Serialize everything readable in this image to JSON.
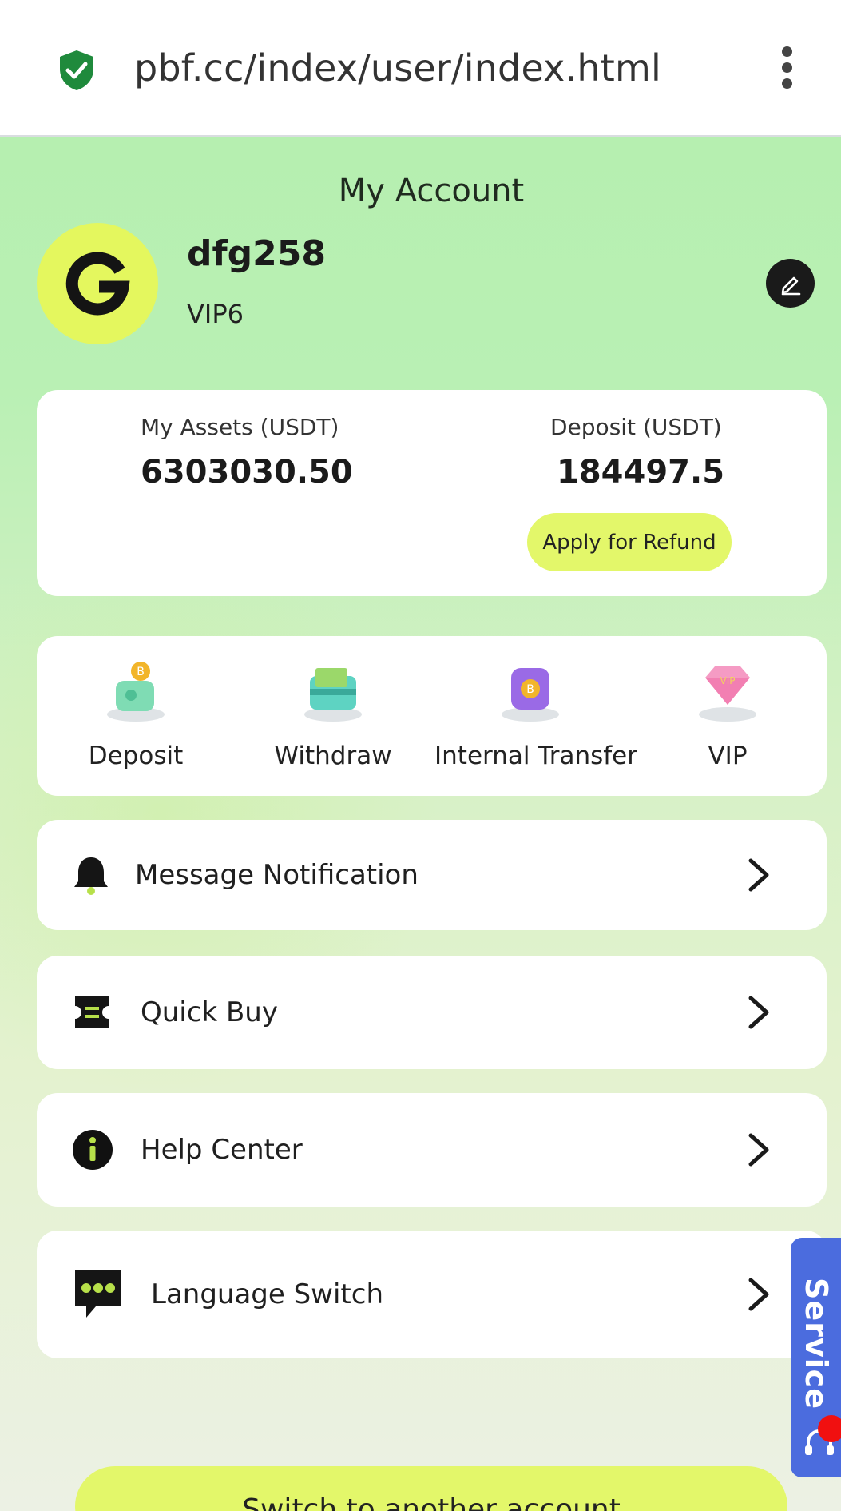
{
  "browser": {
    "url": "pbf.cc/index/user/index.html",
    "secure_icon": "shield-check-icon",
    "menu_icon": "kebab-menu-icon"
  },
  "header": {
    "title": "My Account"
  },
  "profile": {
    "avatar_letter": "G",
    "username": "dfg258",
    "vip_level": "VIP6",
    "edit_icon": "pencil-icon"
  },
  "assets": {
    "assets_label": "My Assets (USDT)",
    "assets_value": "6303030.50",
    "deposit_label": "Deposit (USDT)",
    "deposit_value": "184497.5",
    "refund_button": "Apply for Refund"
  },
  "quick_actions": [
    {
      "label": "Deposit",
      "icon": "piggy-bank-coin-icon"
    },
    {
      "label": "Withdraw",
      "icon": "wallet-cash-icon"
    },
    {
      "label": "Internal Transfer",
      "icon": "transfer-coin-icon"
    },
    {
      "label": "VIP",
      "icon": "diamond-icon"
    }
  ],
  "menu": [
    {
      "label": "Message Notification",
      "icon": "bell-icon"
    },
    {
      "label": "Quick Buy",
      "icon": "ticket-icon"
    },
    {
      "label": "Help Center",
      "icon": "info-icon"
    },
    {
      "label": "Language Switch",
      "icon": "chat-bubble-icon"
    }
  ],
  "service": {
    "label": "Service",
    "icon": "headset-icon"
  },
  "footer": {
    "switch_button": "Switch to another account"
  },
  "colors": {
    "accent": "#e3f76a",
    "background_top": "#b6efb0",
    "service_blue": "#4b6cde",
    "dark": "#1a1a1a"
  }
}
